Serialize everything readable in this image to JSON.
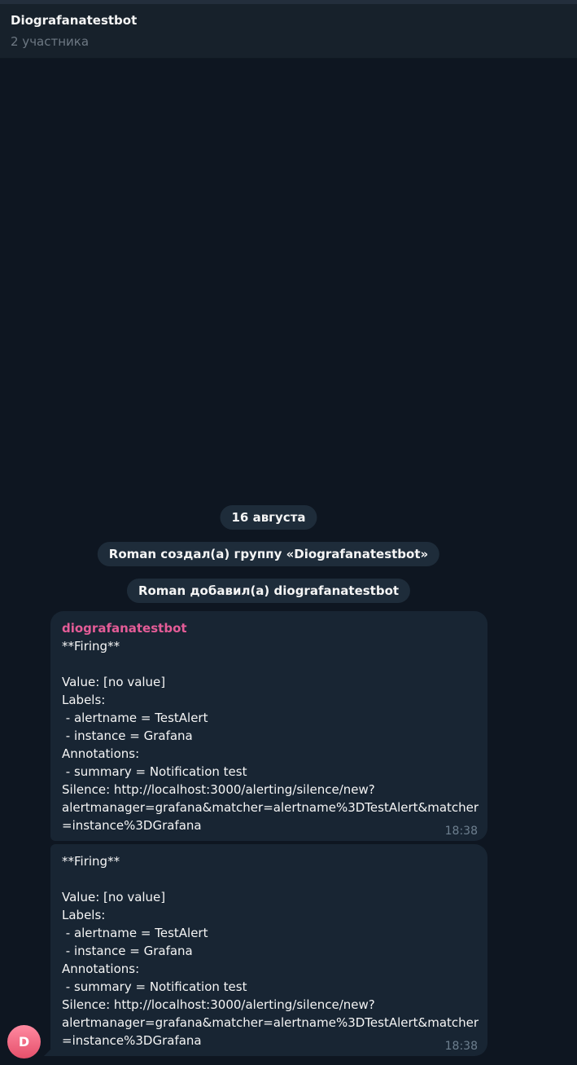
{
  "header": {
    "title": "Diografanatestbot",
    "subtitle": "2 участника"
  },
  "service_messages": [
    {
      "text": "16 августа"
    },
    {
      "text": "Roman создал(а) группу «Diografanatestbot»"
    },
    {
      "text": "Roman добавил(а) diografanatestbot"
    }
  ],
  "messages": [
    {
      "sender": "diografanatestbot",
      "text": "**Firing**\n\nValue: [no value]\nLabels:\n - alertname = TestAlert\n - instance = Grafana\nAnnotations:\n - summary = Notification test\nSilence: http://localhost:3000/alerting/silence/new?\nalertmanager=grafana&matcher=alertname%3DTestAlert&matcher\n=instance%3DGrafana",
      "time": "18:38"
    },
    {
      "sender": "",
      "text": "**Firing**\n\nValue: [no value]\nLabels:\n - alertname = TestAlert\n - instance = Grafana\nAnnotations:\n - summary = Notification test\nSilence: http://localhost:3000/alerting/silence/new?\nalertmanager=grafana&matcher=alertname%3DTestAlert&matcher\n=instance%3DGrafana",
      "time": "18:38"
    }
  ],
  "avatar": {
    "initial": "D"
  },
  "colors": {
    "background": "#0e1621",
    "header": "#17212b",
    "bubble": "#182533",
    "sender_name": "#e45c97",
    "timestamp": "#6d7f8f",
    "avatar": "#f0657f"
  }
}
